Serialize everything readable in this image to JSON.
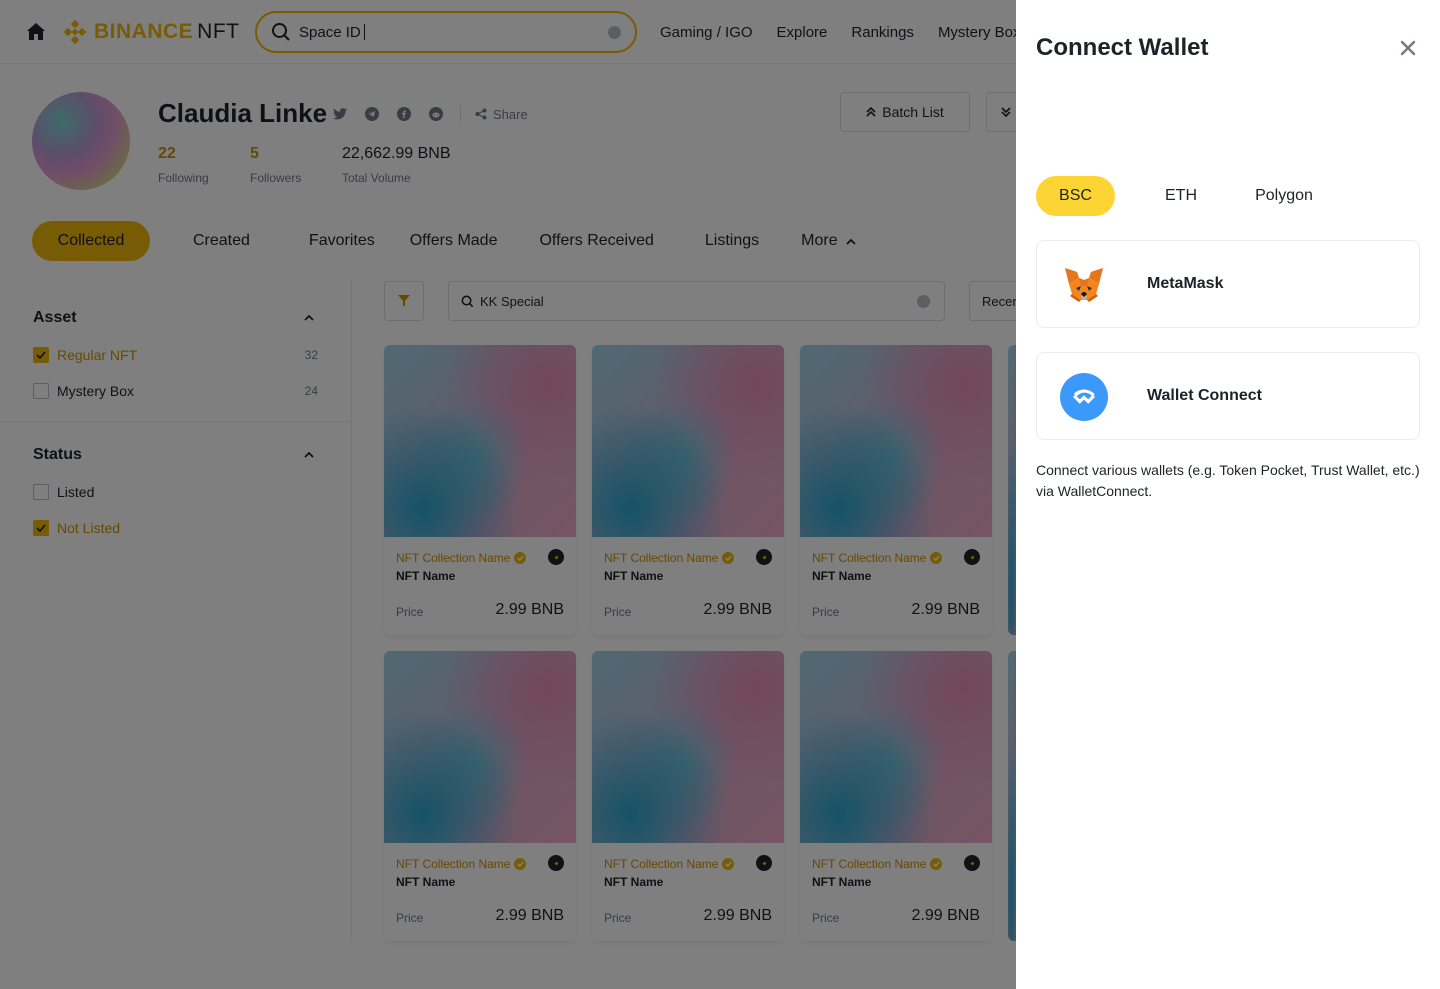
{
  "header": {
    "brand": "BINANCE",
    "brand_suffix": "NFT",
    "search_value": "Space ID",
    "nav": [
      "Gaming / IGO",
      "Explore",
      "Rankings",
      "Mystery Box"
    ]
  },
  "profile": {
    "name": "Claudia Linke",
    "share_label": "Share",
    "following_count": "22",
    "following_label": "Following",
    "followers_count": "5",
    "followers_label": "Followers",
    "volume": "22,662.99 BNB",
    "volume_label": "Total Volume",
    "batch_list_label": "Batch List"
  },
  "tabs": {
    "collected": "Collected",
    "created": "Created",
    "favorites": "Favorites",
    "offers_made": "Offers Made",
    "offers_received": "Offers Received",
    "listings": "Listings",
    "more": "More"
  },
  "filters": {
    "asset_title": "Asset",
    "asset_items": [
      {
        "label": "Regular NFT",
        "count": "32",
        "checked": true
      },
      {
        "label": "Mystery Box",
        "count": "24",
        "checked": false
      }
    ],
    "status_title": "Status",
    "status_items": [
      {
        "label": "Listed",
        "checked": false
      },
      {
        "label": "Not Listed",
        "checked": true
      }
    ]
  },
  "toolbar": {
    "search_value": "KK Special",
    "sort_label": "Recent"
  },
  "card": {
    "collection": "NFT Collection Name",
    "name": "NFT Name",
    "price_label": "Price",
    "price": "2.99 BNB"
  },
  "drawer": {
    "title": "Connect Wallet",
    "chains": [
      "BSC",
      "ETH",
      "Polygon"
    ],
    "active_chain": "BSC",
    "wallets": [
      "MetaMask",
      "Wallet Connect"
    ],
    "note": "Connect various wallets (e.g. Token Pocket, Trust Wallet, etc.) via WalletConnect."
  },
  "colors": {
    "brand_yellow": "#f0b90b",
    "chain_tab_active": "#fcd535",
    "accent_text": "#c99400",
    "walletconnect_blue": "#3b99fc",
    "overlay": "rgba(0,0,0,0.5)"
  }
}
